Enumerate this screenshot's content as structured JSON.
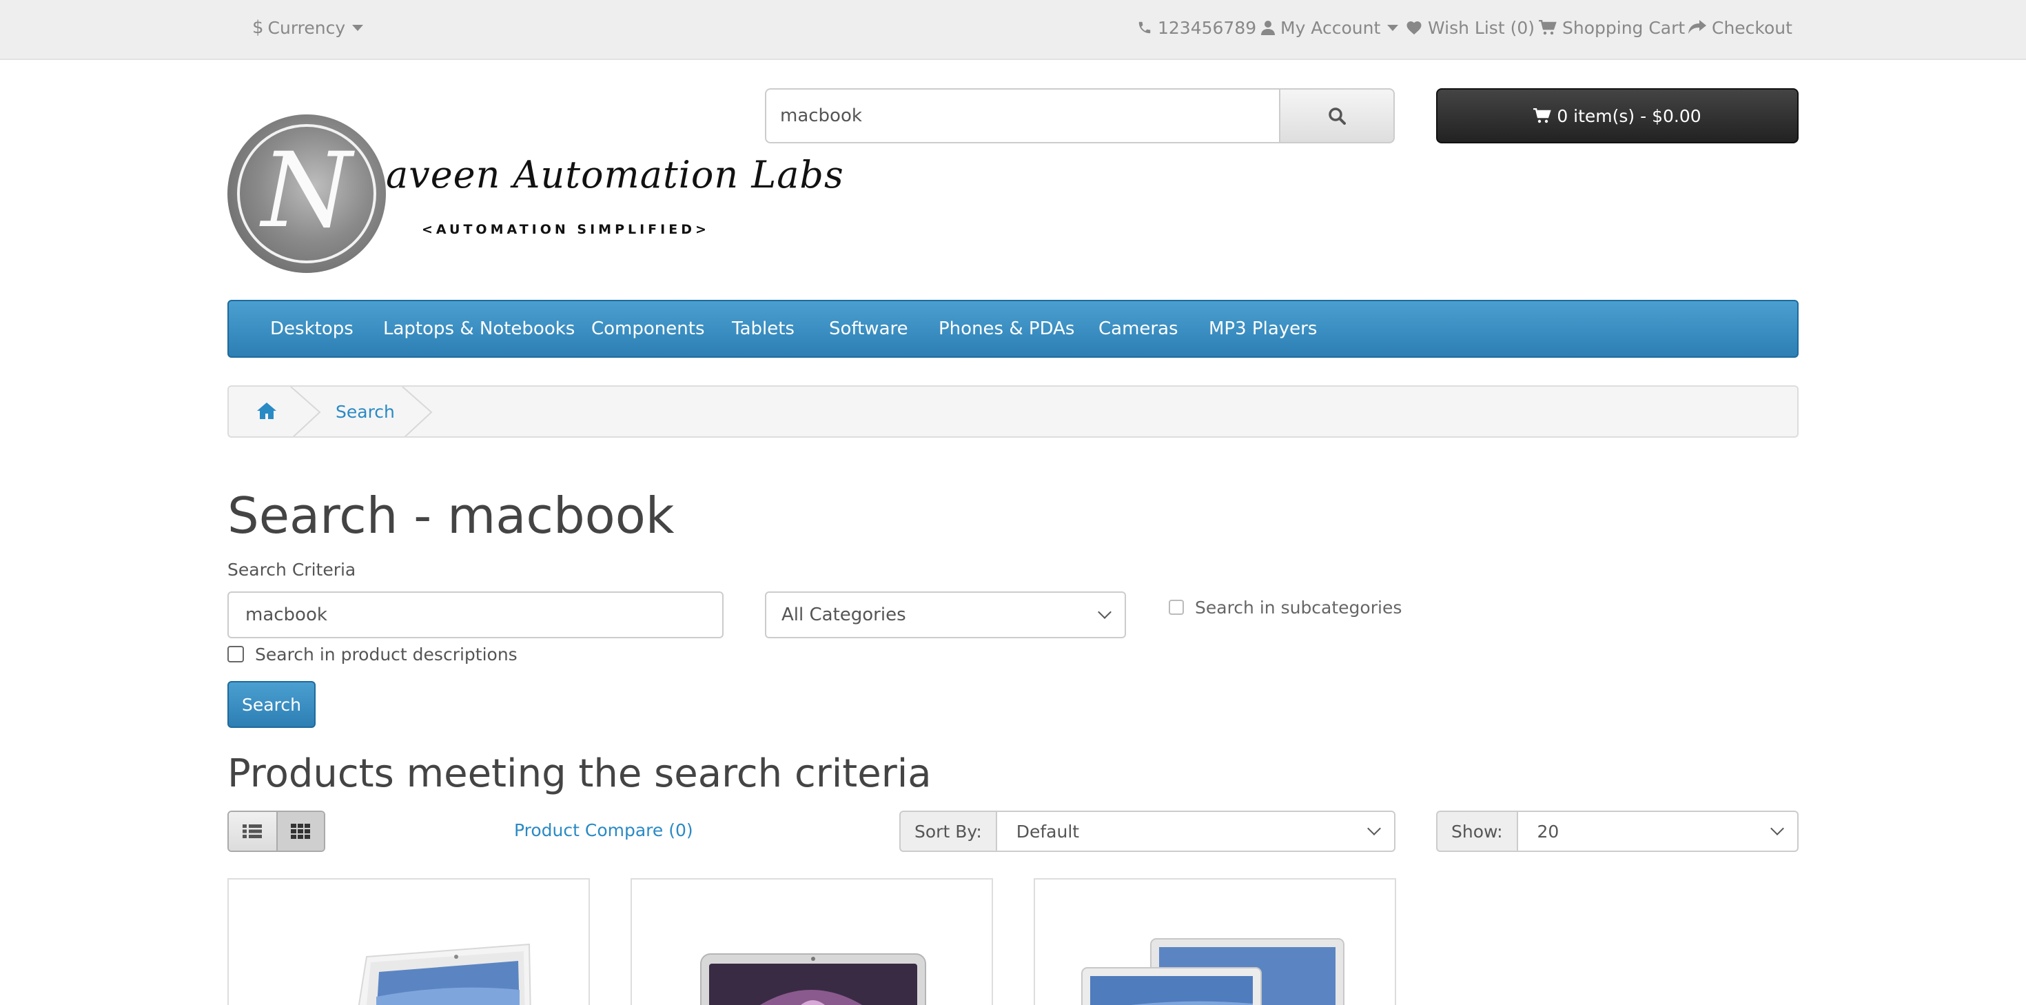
{
  "topbar": {
    "currency_label": "Currency",
    "phone": "123456789",
    "account_label": "My Account",
    "wishlist_label": "Wish List (0)",
    "cart_label": "Shopping Cart",
    "checkout_label": "Checkout"
  },
  "logo": {
    "letter": "N",
    "name": "aveen Automation Labs",
    "tagline": "<AUTOMATION SIMPLIFIED>"
  },
  "header_search": {
    "value": "macbook"
  },
  "cart_button": {
    "label": "0 item(s) - $0.00"
  },
  "menu": {
    "items": [
      "Desktops",
      "Laptops & Notebooks",
      "Components",
      "Tablets",
      "Software",
      "Phones & PDAs",
      "Cameras",
      "MP3 Players"
    ]
  },
  "breadcrumb": {
    "search_label": "Search"
  },
  "page": {
    "title": "Search - macbook",
    "criteria_label": "Search Criteria",
    "criteria_value": "macbook",
    "category_selected": "All Categories",
    "subcategories_label": "Search in subcategories",
    "descriptions_label": "Search in product descriptions",
    "search_button": "Search",
    "results_title": "Products meeting the search criteria",
    "compare_label": "Product Compare (0)",
    "sort_label": "Sort By:",
    "sort_selected": "Default",
    "show_label": "Show:",
    "show_selected": "20"
  },
  "colors": {
    "accent": "#2d7fb4",
    "link": "#2a8ac4",
    "cart_bg": "#222222"
  }
}
